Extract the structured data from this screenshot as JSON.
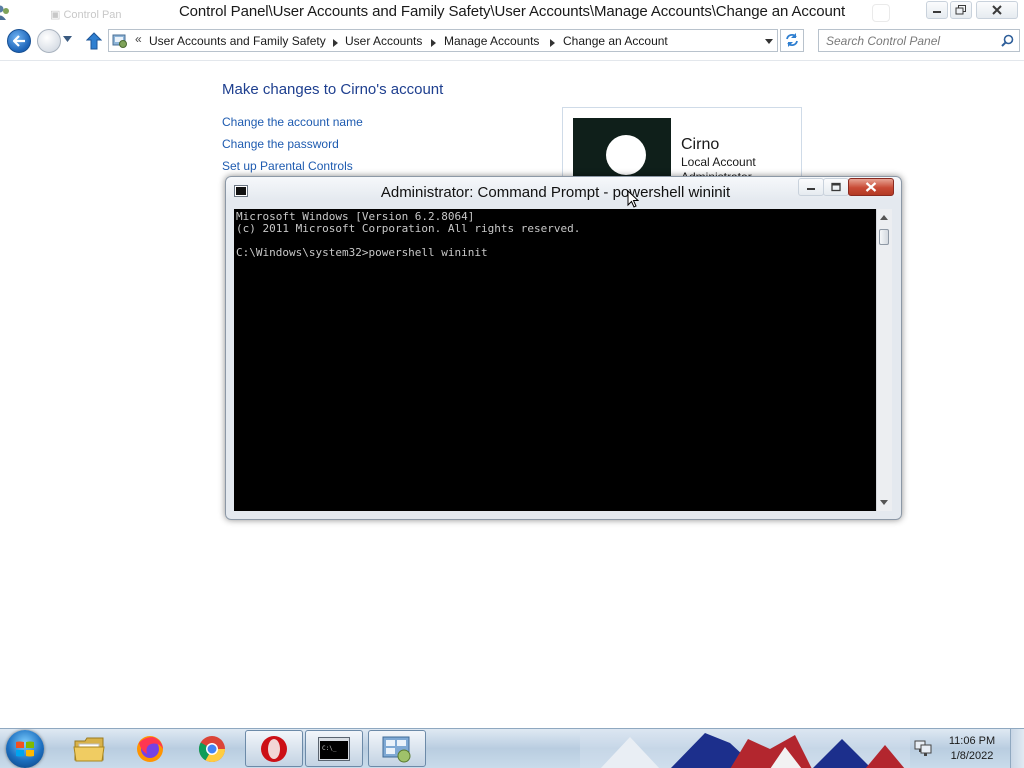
{
  "control_panel": {
    "title": "Control Panel\\User Accounts and Family Safety\\User Accounts\\Manage Accounts\\Change an Account",
    "breadcrumbs": [
      "User Accounts and Family Safety",
      "User Accounts",
      "Manage Accounts",
      "Change an Account"
    ],
    "search_placeholder": "Search Control Panel",
    "heading": "Make changes to Cirno's account",
    "links": [
      "Change the account name",
      "Change the password",
      "Set up Parental Controls"
    ],
    "account": {
      "name": "Cirno",
      "type": "Local Account",
      "role": "Administrator"
    }
  },
  "cmd": {
    "title": "Administrator: Command Prompt - powershell  wininit",
    "lines": [
      "Microsoft Windows [Version 6.2.8064]",
      "(c) 2011 Microsoft Corporation. All rights reserved.",
      "",
      "C:\\Windows\\system32>powershell wininit"
    ]
  },
  "taskbar": {
    "items": [
      "explorer-icon",
      "firefox-icon",
      "chrome-icon",
      "opera-icon",
      "cmd-icon",
      "control-panel-icon"
    ],
    "active_items": [
      "cmd-icon",
      "control-panel-icon"
    ],
    "clock_time": "11:06 PM",
    "clock_date": "1/8/2022"
  },
  "colors": {
    "link": "#1e5bb0",
    "heading": "#1e3f8f",
    "console_bg": "#000000",
    "console_text": "#c8c8c8",
    "close_button": "#c84a35"
  }
}
